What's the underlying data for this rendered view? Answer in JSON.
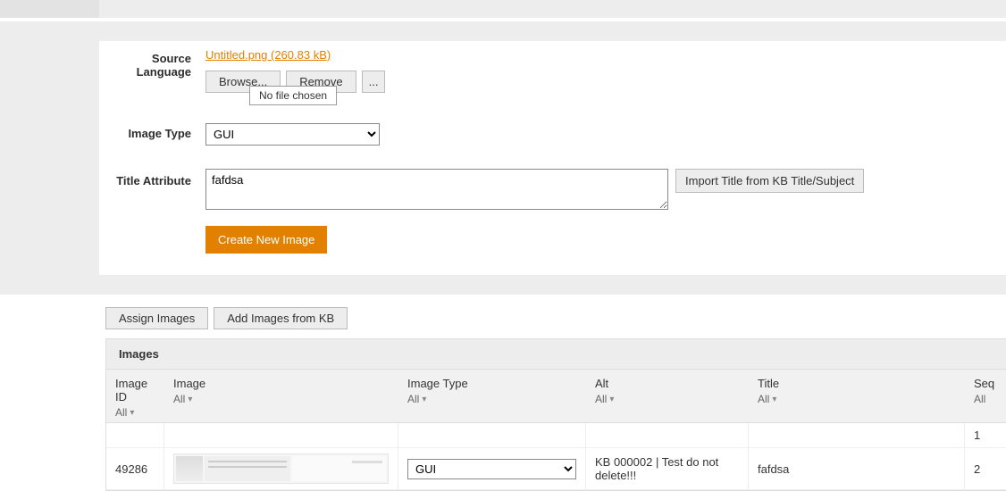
{
  "form": {
    "source_language_label": "Source Language",
    "file_link": "Untitled.png (260.83 kB)",
    "browse_label": "Browse...",
    "remove_label": "Remove",
    "more_label": "...",
    "tooltip": "No file chosen",
    "image_type_label": "Image Type",
    "image_type_value": "GUI",
    "title_attr_label": "Title Attribute",
    "title_attr_value": "fafdsa",
    "import_title_label": "Import Title from KB Title/Subject",
    "create_label": "Create New Image"
  },
  "actions": {
    "assign_label": "Assign Images",
    "add_from_kb_label": "Add Images from KB"
  },
  "images_panel": {
    "header": "Images",
    "filter_all": "All",
    "columns": {
      "id": "Image ID",
      "image": "Image",
      "type": "Image Type",
      "alt": "Alt",
      "title": "Title",
      "seq": "Seq"
    },
    "rows": [
      {
        "id": "",
        "type": "",
        "alt": "",
        "title": "",
        "seq": "1"
      },
      {
        "id": "49286",
        "type": "GUI",
        "alt": "KB 000002 | Test do not delete!!!",
        "title": "fafdsa",
        "seq": "2"
      }
    ]
  }
}
